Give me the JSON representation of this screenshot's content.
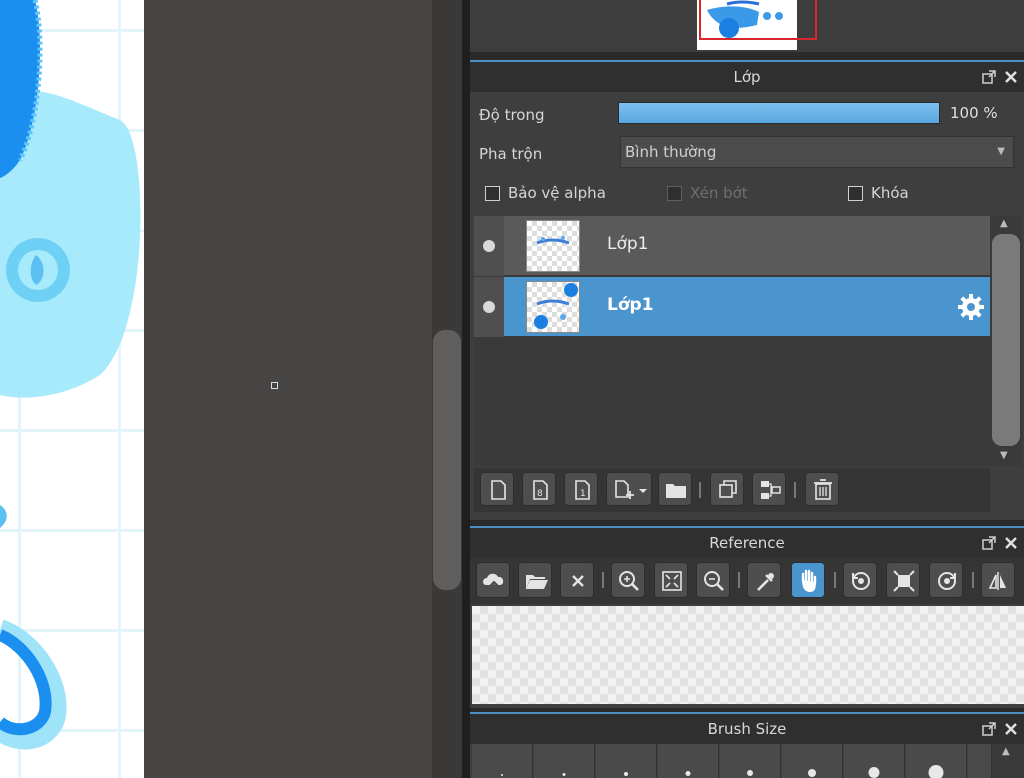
{
  "layer_panel": {
    "title": "Lớp",
    "opacity_label": "Độ trong",
    "opacity_value": "100 %",
    "opacity_level": 1.0,
    "blend_label": "Pha trộn",
    "blend_value": "Bình thường",
    "checkboxes": [
      {
        "label": "Bảo vệ alpha",
        "checked": false,
        "enabled": true
      },
      {
        "label": "Xén bớt",
        "checked": false,
        "enabled": false
      },
      {
        "label": "Khóa",
        "checked": false,
        "enabled": true
      }
    ],
    "layers": [
      {
        "name": "Lớp1",
        "selected": false,
        "visible": true
      },
      {
        "name": "Lớp1",
        "selected": true,
        "visible": true
      }
    ],
    "toolbar_icons": [
      "new-layer-icon",
      "new-8bit-layer-icon",
      "new-1bit-layer-icon",
      "add-layer-dropdown-icon",
      "folder-icon",
      "duplicate-layer-icon",
      "merge-layer-icon",
      "trash-icon"
    ]
  },
  "reference_panel": {
    "title": "Reference",
    "toolbar_icons": [
      "upload-cloud-icon",
      "open-folder-icon",
      "close-icon",
      "zoom-in-icon",
      "fit-icon",
      "zoom-out-icon",
      "eyedropper-icon",
      "hand-icon",
      "rotate-left-icon",
      "fit-screen-icon",
      "rotate-right-icon",
      "flip-icon"
    ],
    "active_tool": "hand-icon"
  },
  "brush_panel": {
    "title": "Brush Size"
  },
  "colors": {
    "accent": "#4b95cf",
    "panel_bg": "#3e3e3e",
    "header_bg": "#2f2f2f",
    "workspace_bg": "#464544",
    "canvas_blue": "#1e90ee",
    "canvas_light_blue": "#8fdff8",
    "nav_frame": "#d9272e"
  }
}
